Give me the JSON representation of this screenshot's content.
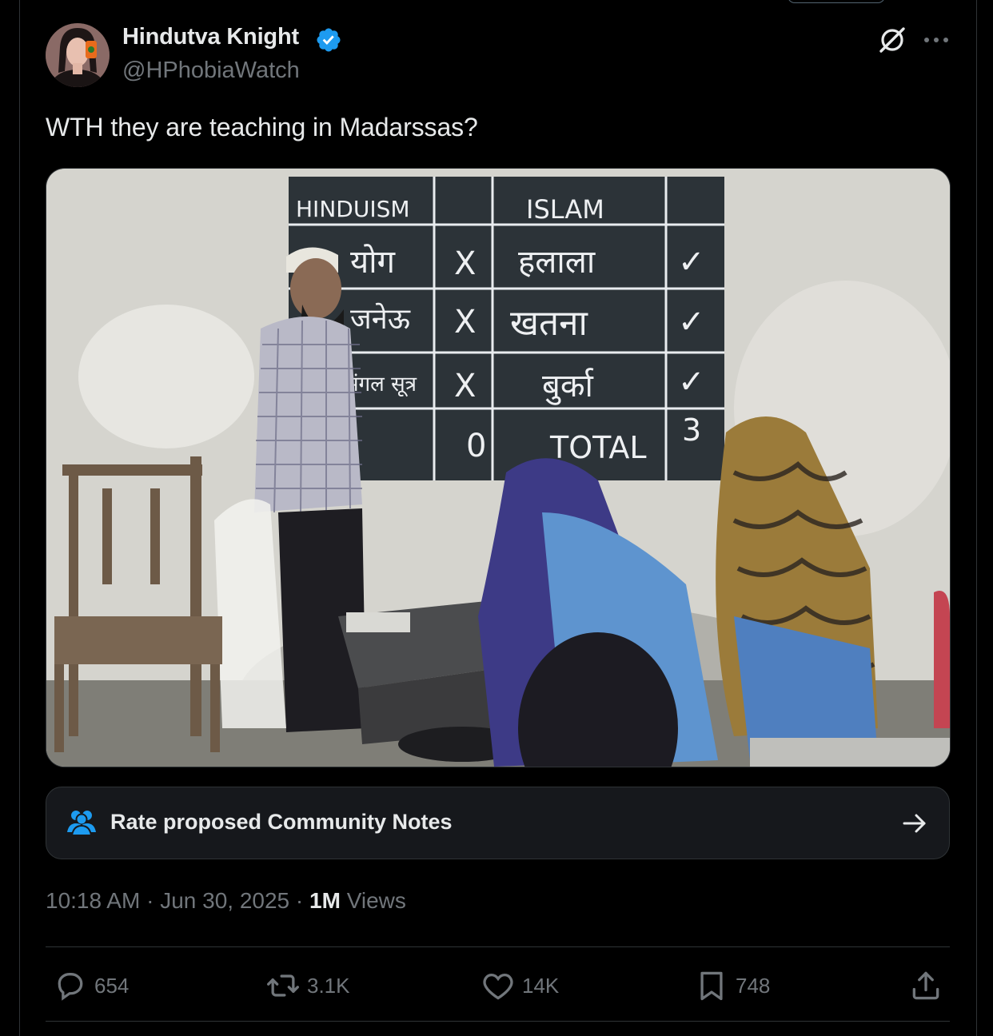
{
  "tweet": {
    "author": {
      "display_name": "Hindutva Knight",
      "handle": "@HPhobiaWatch",
      "verified": true,
      "verified_color": "#1d9bf0"
    },
    "text": "WTH they are teaching in Madarssas?",
    "image": {
      "board": {
        "header_left": "HINDUISM",
        "header_right": "ISLAM",
        "rows": [
          {
            "left": "योग",
            "left_mark": "X",
            "right": "हलाला",
            "right_mark": "✓"
          },
          {
            "left": "जनेऊ",
            "left_mark": "X",
            "right": "खतना",
            "right_mark": "✓"
          },
          {
            "left": "मंगल सूत्र",
            "left_mark": "X",
            "right": "बुर्का",
            "right_mark": "✓"
          }
        ],
        "left_total": "0",
        "total_label": "TOTAL",
        "right_total": "3"
      }
    },
    "community_notes": {
      "label": "Rate proposed Community Notes",
      "icon": "people-icon",
      "icon_color": "#1d9bf0"
    },
    "meta": {
      "time": "10:18 AM",
      "separator": "·",
      "date": "Jun 30, 2025",
      "views_count": "1M",
      "views_label": "Views"
    },
    "actions": {
      "replies": "654",
      "reposts": "3.1K",
      "likes": "14K",
      "bookmarks": "748"
    }
  },
  "colors": {
    "background": "#000000",
    "text_primary": "#e7e9ea",
    "text_secondary": "#71767b",
    "border": "#2f3336",
    "notes_bg": "#16181c"
  }
}
